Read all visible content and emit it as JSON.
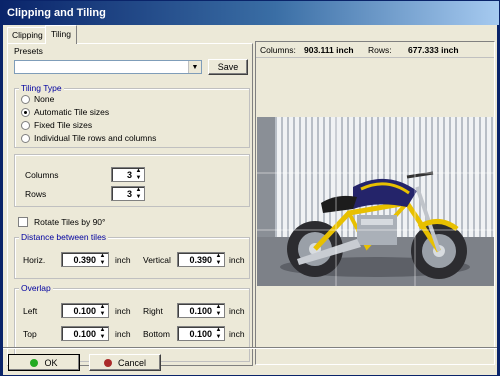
{
  "window": {
    "title": "Clipping and Tiling"
  },
  "tabs": [
    {
      "label": "Clipping",
      "active": false
    },
    {
      "label": "Tiling",
      "active": true
    }
  ],
  "presets": {
    "label": "Presets",
    "value": "",
    "save_label": "Save"
  },
  "tiling_type": {
    "title": "Tiling Type",
    "options": [
      {
        "label": "None",
        "checked": false
      },
      {
        "label": "Automatic Tile sizes",
        "checked": true
      },
      {
        "label": "Fixed Tile sizes",
        "checked": false
      },
      {
        "label": "Individual Tile rows and columns",
        "checked": false
      }
    ]
  },
  "grid": {
    "columns_label": "Columns",
    "columns_value": "3",
    "rows_label": "Rows",
    "rows_value": "3"
  },
  "rotate": {
    "label": "Rotate Tiles by 90°",
    "checked": false
  },
  "distance": {
    "title": "Distance between tiles",
    "horiz_label": "Horiz.",
    "horiz_value": "0.390",
    "horiz_unit": "inch",
    "vertical_label": "Vertical",
    "vertical_value": "0.390",
    "vertical_unit": "inch"
  },
  "overlap": {
    "title": "Overlap",
    "left_label": "Left",
    "left_value": "0.100",
    "left_unit": "inch",
    "right_label": "Right",
    "right_value": "0.100",
    "right_unit": "inch",
    "top_label": "Top",
    "top_value": "0.100",
    "top_unit": "inch",
    "bottom_label": "Bottom",
    "bottom_value": "0.100",
    "bottom_unit": "inch"
  },
  "preview": {
    "columns_label": "Columns:",
    "columns_value": "903.111 inch",
    "rows_label": "Rows:",
    "rows_value": "677.333 inch",
    "icon": "motorcycle-photo"
  },
  "buttons": {
    "ok_label": "OK",
    "ok_icon": "green-dot-icon",
    "cancel_label": "Cancel",
    "cancel_icon": "cancel-dot-icon"
  },
  "colors": {
    "title_start": "#0a246a",
    "title_end": "#a6caf0",
    "group_title": "#0000a0",
    "ok_icon": "#22aa22",
    "cancel_icon": "#aa2a2a"
  }
}
